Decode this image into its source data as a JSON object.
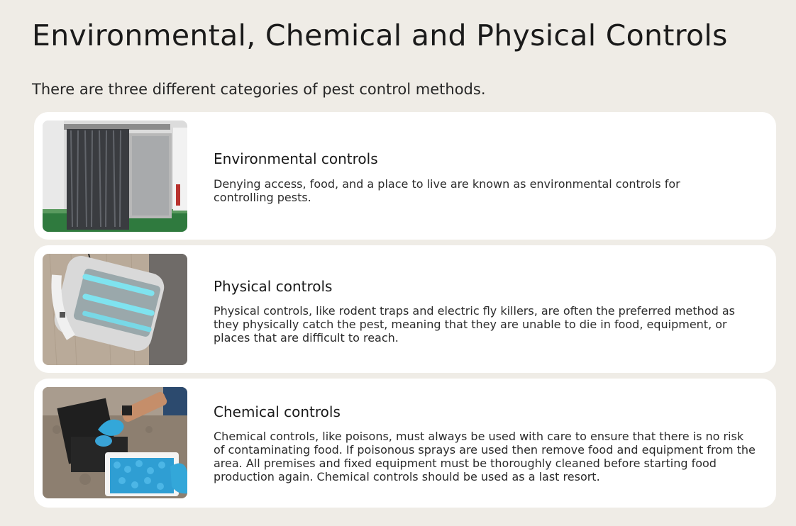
{
  "page": {
    "title": "Environmental, Chemical and Physical Controls",
    "intro": "There are three different categories of pest control methods."
  },
  "cards": [
    {
      "title": "Environmental controls",
      "description": "Denying access, food, and a place to live are known as environmental controls for controlling pests.",
      "image_icon": "strip-curtain-door-image"
    },
    {
      "title": "Physical controls",
      "description": "Physical controls, like rodent traps and electric fly killers, are often the preferred method as they physically catch the pest, meaning that they are unable to die in food, equipment, or places that are difficult to reach.",
      "image_icon": "electric-fly-killer-image"
    },
    {
      "title": "Chemical controls",
      "description": "Chemical controls, like poisons, must always be used with care to ensure that there is no risk of contaminating food. If poisonous sprays are used then remove food and equipment from the area. All premises and fixed equipment must be thoroughly cleaned before starting food production again. Chemical controls should be used as a last resort.",
      "image_icon": "bait-station-image"
    }
  ],
  "colors": {
    "background": "#efece6",
    "card": "#ffffff",
    "text": "#1a1a1a"
  }
}
